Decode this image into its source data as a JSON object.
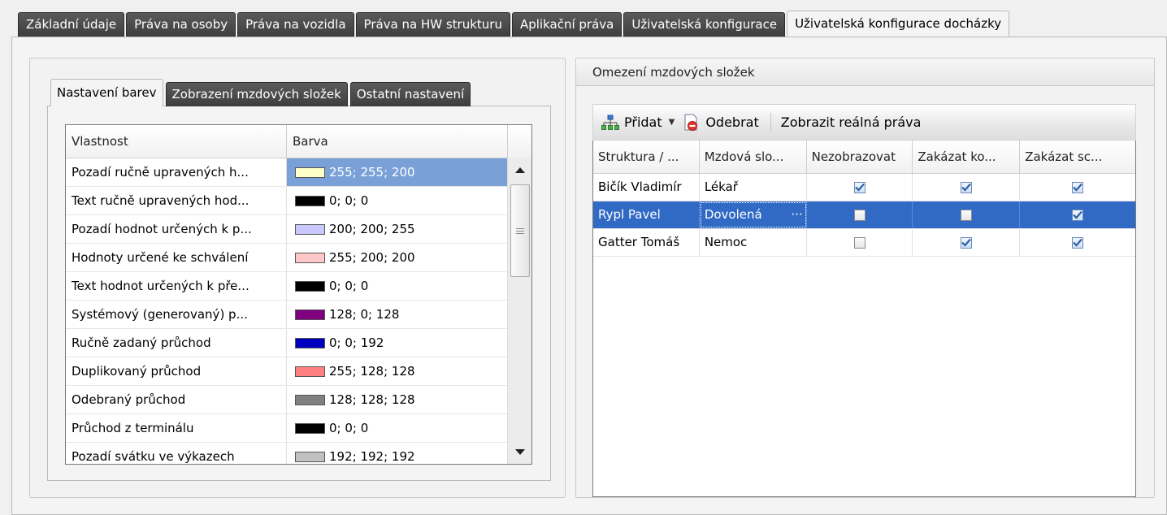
{
  "top_tabs": [
    {
      "label": "Základní údaje",
      "active": false
    },
    {
      "label": "Práva na osoby",
      "active": false
    },
    {
      "label": "Práva na vozidla",
      "active": false
    },
    {
      "label": "Práva na HW strukturu",
      "active": false
    },
    {
      "label": "Aplikační práva",
      "active": false
    },
    {
      "label": "Uživatelská konfigurace",
      "active": false
    },
    {
      "label": "Uživatelská konfigurace docházky",
      "active": true
    }
  ],
  "left": {
    "sub_tabs": [
      {
        "label": "Nastavení barev",
        "active": true
      },
      {
        "label": "Zobrazení mzdových složek",
        "active": false
      },
      {
        "label": "Ostatní nastavení",
        "active": false
      }
    ],
    "grid": {
      "headers": {
        "property": "Vlastnost",
        "color": "Barva"
      },
      "rows": [
        {
          "property": "Pozadí ručně upravených h...",
          "value": "255; 255; 200",
          "swatch": "#ffffc8",
          "selected": true
        },
        {
          "property": "Text ručně upravených hod...",
          "value": "0; 0; 0",
          "swatch": "#000000",
          "selected": false
        },
        {
          "property": "Pozadí hodnot určených k p...",
          "value": "200; 200; 255",
          "swatch": "#c8c8ff",
          "selected": false
        },
        {
          "property": "Hodnoty určené ke schválení",
          "value": "255; 200; 200",
          "swatch": "#ffc8c8",
          "selected": false
        },
        {
          "property": "Text hodnot určených k pře...",
          "value": "0; 0; 0",
          "swatch": "#000000",
          "selected": false
        },
        {
          "property": "Systémový (generovaný) p...",
          "value": "128; 0; 128",
          "swatch": "#800080",
          "selected": false
        },
        {
          "property": "Ručně zadaný průchod",
          "value": "0; 0; 192",
          "swatch": "#0000c0",
          "selected": false
        },
        {
          "property": "Duplikovaný průchod",
          "value": "255; 128; 128",
          "swatch": "#ff8080",
          "selected": false
        },
        {
          "property": "Odebraný průchod",
          "value": "128; 128; 128",
          "swatch": "#808080",
          "selected": false
        },
        {
          "property": "Průchod z terminálu",
          "value": "0; 0; 0",
          "swatch": "#000000",
          "selected": false
        },
        {
          "property": "Pozadí svátku ve výkazech",
          "value": "192; 192; 192",
          "swatch": "#c0c0c0",
          "selected": false
        }
      ]
    }
  },
  "right": {
    "title": "Omezení mzdových složek",
    "toolbar": {
      "add_label": "Přidat",
      "remove_label": "Odebrat",
      "show_real_label": "Zobrazit reálná práva"
    },
    "grid": {
      "headers": [
        "Struktura / ...",
        "Mzdová slo...",
        "Nezobrazovat",
        "Zakázat ko...",
        "Zakázat sc..."
      ],
      "rows": [
        {
          "structure": "Bičík Vladimír",
          "component": "Lékař",
          "hide": true,
          "deny_ko": true,
          "deny_sc": true,
          "selected": false
        },
        {
          "structure": "Rypl Pavel",
          "component": "Dovolená",
          "hide": false,
          "deny_ko": false,
          "deny_sc": true,
          "selected": true
        },
        {
          "structure": "Gatter Tomáš",
          "component": "Nemoc",
          "hide": false,
          "deny_ko": true,
          "deny_sc": true,
          "selected": false
        }
      ]
    }
  },
  "colors": {
    "selection": "#316ac5",
    "color_cell_selection": "#7aa0d8",
    "tab_dark": "#4a4a4a",
    "check": "#2a5fa8"
  }
}
